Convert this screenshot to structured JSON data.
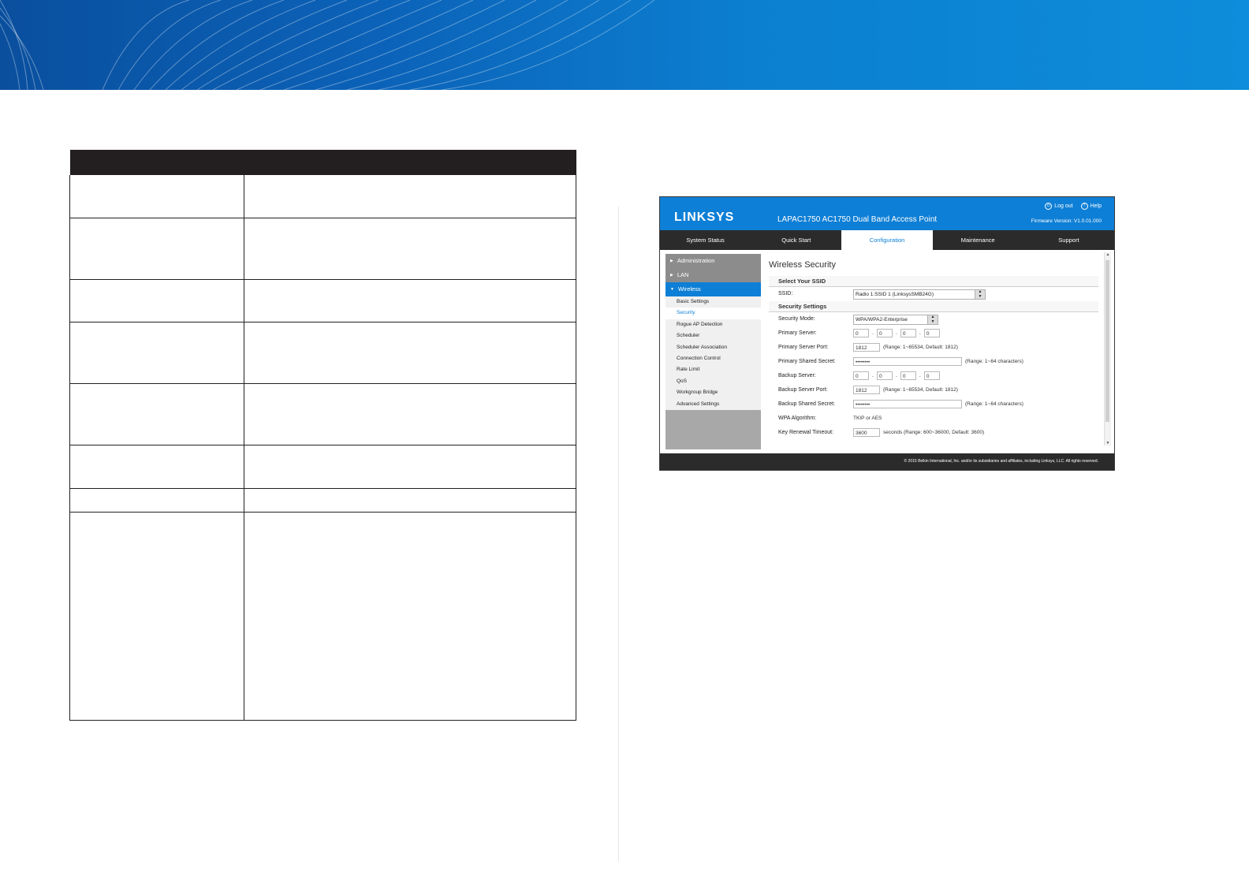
{
  "colors": {
    "brand_blue": "#0e7fd6",
    "nav_dark": "#2b2b2b",
    "table_header": "#231f20"
  },
  "router": {
    "logo": "LINKSYS",
    "title": "LAPAC1750 AC1750 Dual Band Access Point",
    "logout_label": "Log out",
    "help_label": "Help",
    "firmware": "Firmware Version: V1.0.01.000",
    "tabs": [
      "System Status",
      "Quick Start",
      "Configuration",
      "Maintenance",
      "Support"
    ],
    "active_tab": "Configuration",
    "sidebar": {
      "groups": [
        "Administration",
        "LAN",
        "Wireless"
      ],
      "active_group": "Wireless",
      "sub_items": [
        "Basic Settings",
        "Security",
        "Rogue AP Detection",
        "Scheduler",
        "Scheduler Association",
        "Connection Control",
        "Rate Limit",
        "QoS",
        "Workgroup Bridge",
        "Advanced Settings"
      ],
      "active_sub": "Security"
    },
    "main": {
      "page_title": "Wireless Security",
      "section_ssid": "Select Your SSID",
      "ssid_label": "SSID:",
      "ssid_value": "Radio 1:SSID 1 (LinksysSMB24G)",
      "section_security": "Security Settings",
      "security_mode_label": "Security Mode:",
      "security_mode_value": "WPA/WPA2-Enterprise",
      "primary_server_label": "Primary Server:",
      "primary_server_octets": [
        "0",
        "0",
        "0",
        "0"
      ],
      "primary_port_label": "Primary Server Port:",
      "primary_port_value": "1812",
      "port_hint": "(Range: 1~65534, Default: 1812)",
      "primary_secret_label": "Primary Shared Secret:",
      "secret_value": "••••••••",
      "secret_hint": "(Range: 1~64 characters)",
      "backup_server_label": "Backup Server:",
      "backup_server_octets": [
        "0",
        "0",
        "0",
        "0"
      ],
      "backup_port_label": "Backup Server Port:",
      "backup_port_value": "1812",
      "backup_secret_label": "Backup Shared Secret:",
      "wpa_algorithm_label": "WPA Algorithm:",
      "wpa_algorithm_value": "TKIP or AES",
      "key_timeout_label": "Key Renewal Timeout:",
      "key_timeout_value": "3600",
      "key_timeout_hint": "seconds (Range: 600~36000, Default: 3600)"
    },
    "footer": "© 2015 Belkin International, Inc. and/or its subsidiaries and affiliates, including Linksys, LLC. All rights reserved."
  }
}
